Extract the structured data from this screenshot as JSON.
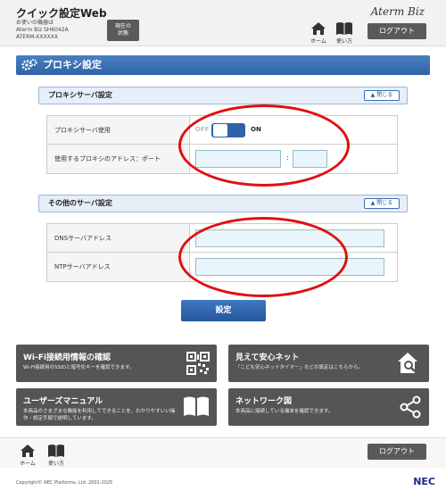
{
  "header": {
    "title": "クイック設定Web",
    "device_line1": "お使いの機器は",
    "device_line2": "Aterm Biz SH6042A",
    "device_line3": "ATERM-XXXXXX",
    "status_line1": "現在の",
    "status_line2": "状態",
    "brand": "Aterm Biz",
    "home_label": "ホーム",
    "guide_label": "使い方",
    "logout_label": "ログアウト"
  },
  "section": {
    "title": "プロキシ設定"
  },
  "proxy_panel": {
    "heading": "プロキシサーバ設定",
    "close_label": "閉じる",
    "rows": [
      {
        "label": "プロキシサーバ使用"
      },
      {
        "label": "使用するプロキシのアドレス：ポート"
      }
    ],
    "toggle_off": "OFF",
    "toggle_on": "ON",
    "colon": ":",
    "address_value": "",
    "port_value": ""
  },
  "other_panel": {
    "heading": "その他のサーバ設定",
    "close_label": "閉じる",
    "rows": [
      {
        "label": "DNSサーバアドレス",
        "value": ""
      },
      {
        "label": "NTPサーバアドレス",
        "value": ""
      }
    ]
  },
  "submit_label": "設定",
  "tiles": [
    {
      "title": "Wi-Fi接続用情報の確認",
      "desc": "Wi-Fi接続用のSSIDと暗号化キーを確認できます。",
      "icon": "qr-code-icon"
    },
    {
      "title": "見えて安心ネット",
      "desc": "「こども安心ネットタイマー」などの設定はこちらから。",
      "icon": "house-search-icon"
    },
    {
      "title": "ユーザーズマニュアル",
      "desc": "本商品のさまざまな機能を利用してできることを、わかりやすいい操作・設定手順で説明しています。",
      "icon": "book-icon"
    },
    {
      "title": "ネットワーク図",
      "desc": "本商品に接続している端末を確認できます。",
      "icon": "share-icon"
    }
  ],
  "footer": {
    "home_label": "ホーム",
    "guide_label": "使い方",
    "logout_label": "ログアウト",
    "copyright": "Copyright© NEC Platforms, Ltd. 2001-2025",
    "nec": "NEC"
  },
  "colors": {
    "accent": "#2f63a8",
    "annotation": "#e01010",
    "tile": "#555555"
  }
}
